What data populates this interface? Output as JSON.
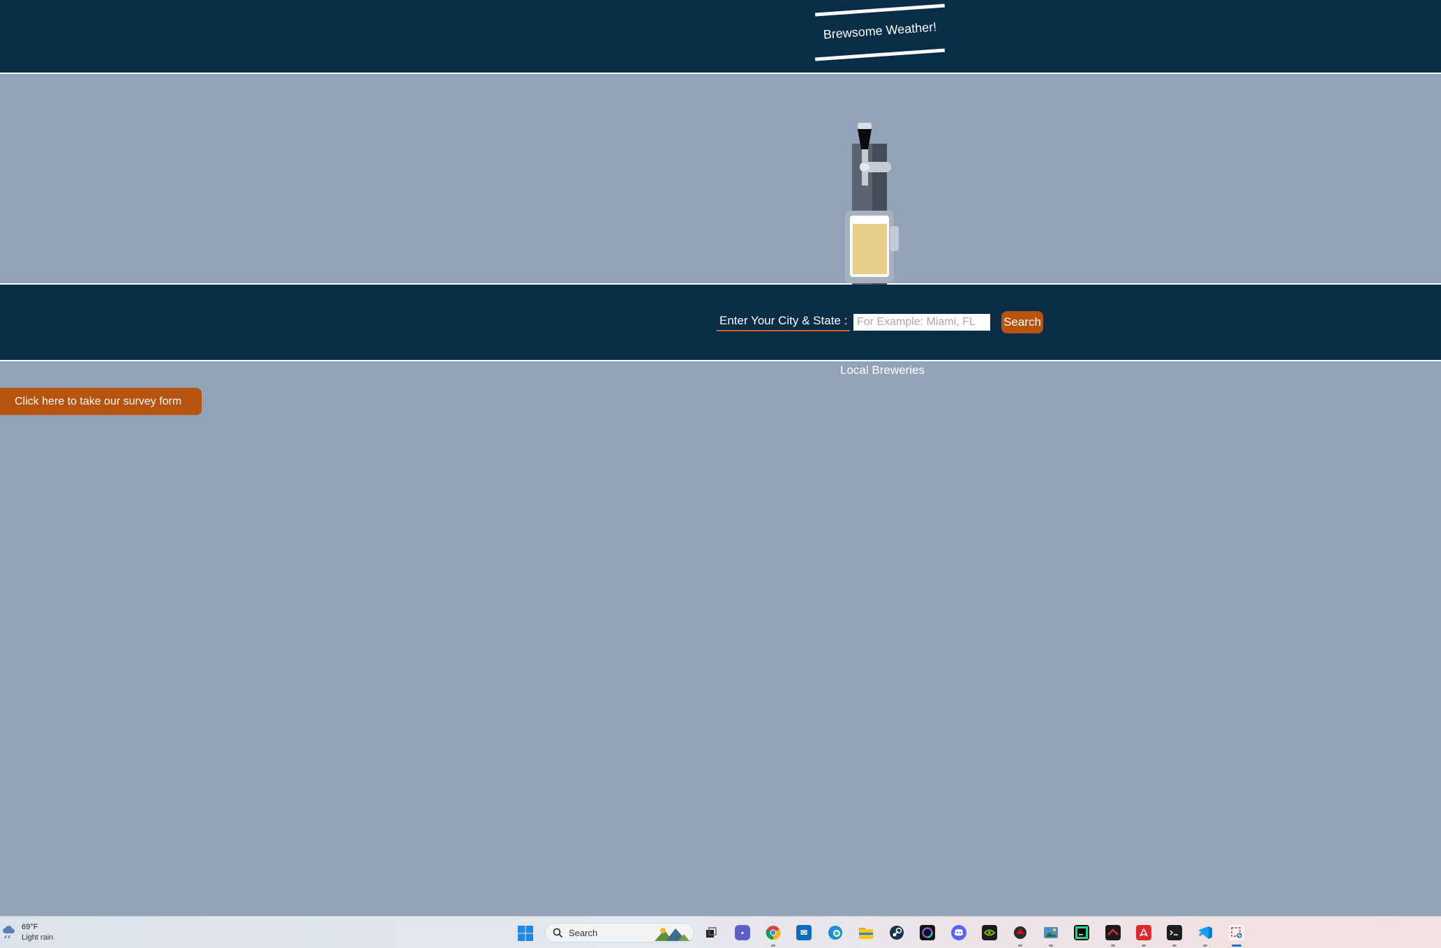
{
  "header": {
    "title": "Brewsome Weather!"
  },
  "search": {
    "label": "Enter Your City & State :",
    "placeholder": "For Example: Miami, FL",
    "button": "Search"
  },
  "breweries": {
    "heading": "Local Breweries"
  },
  "survey": {
    "button": "Click here to take our survey form"
  },
  "taskbar": {
    "weather": {
      "temp": "69°F",
      "desc": "Light rain"
    },
    "search_label": "Search",
    "apps": [
      "task-view",
      "teams",
      "chrome",
      "mail",
      "edge",
      "file-explorer",
      "steam",
      "nzxt-cam",
      "discord",
      "nvidia",
      "msi-afterburner",
      "photos",
      "pycharm",
      "msi-center",
      "adobe-acrobat",
      "terminal",
      "vscode",
      "snipping-tool"
    ]
  },
  "colors": {
    "navy": "#092c47",
    "slate": "#92a2b8",
    "accent": "#b8530e",
    "beer": "#e7cf8a"
  }
}
